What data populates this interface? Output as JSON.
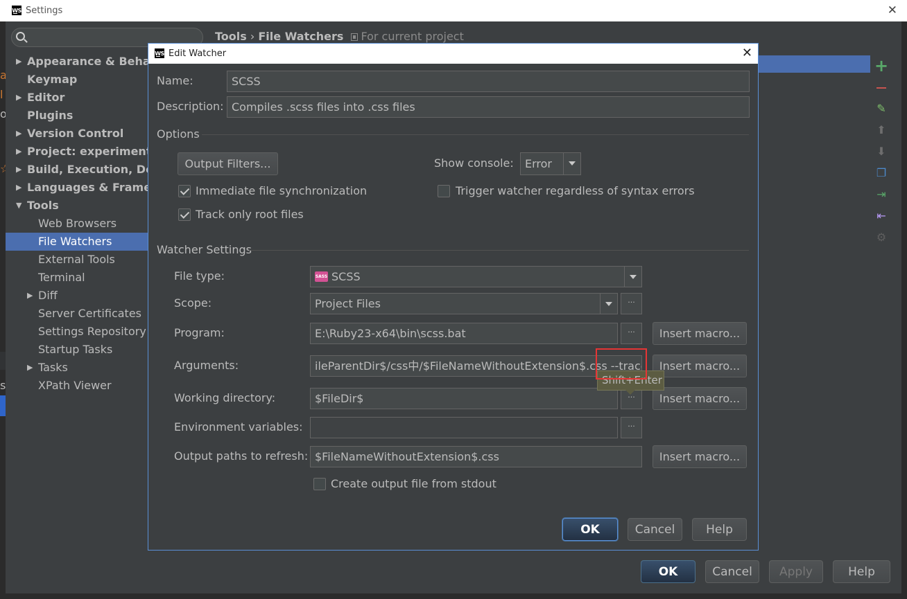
{
  "window": {
    "title": "Settings",
    "logo_text": "WS"
  },
  "sidebar": {
    "items": [
      {
        "label": "Appearance & Behavior",
        "bold": true,
        "arrow": "▶"
      },
      {
        "label": "Keymap",
        "bold": true,
        "arrow": ""
      },
      {
        "label": "Editor",
        "bold": true,
        "arrow": "▶"
      },
      {
        "label": "Plugins",
        "bold": true,
        "arrow": ""
      },
      {
        "label": "Version Control",
        "bold": true,
        "arrow": "▶"
      },
      {
        "label": "Project: experiment",
        "bold": true,
        "arrow": "▶"
      },
      {
        "label": "Build, Execution, Deployment",
        "bold": true,
        "arrow": "▶"
      },
      {
        "label": "Languages & Frameworks",
        "bold": true,
        "arrow": "▶"
      },
      {
        "label": "Tools",
        "bold": true,
        "arrow": "▼"
      },
      {
        "label": "Web Browsers"
      },
      {
        "label": "File Watchers",
        "selected": true
      },
      {
        "label": "External Tools"
      },
      {
        "label": "Terminal"
      },
      {
        "label": "Diff",
        "arrow": "▶"
      },
      {
        "label": "Server Certificates"
      },
      {
        "label": "Settings Repository"
      },
      {
        "label": "Startup Tasks"
      },
      {
        "label": "Tasks",
        "arrow": "▶"
      },
      {
        "label": "XPath Viewer"
      }
    ]
  },
  "breadcrumb": {
    "section": "Tools",
    "separator": "›",
    "page": "File Watchers",
    "scope": "For current project"
  },
  "outer_buttons": {
    "ok": "OK",
    "cancel": "Cancel",
    "apply": "Apply",
    "help": "Help"
  },
  "dialog": {
    "title": "Edit Watcher",
    "name_label": "Name:",
    "name_value": "SCSS",
    "description_label": "Description:",
    "description_value": "Compiles .scss files into .css files",
    "options_header": "Options",
    "output_filters_button": "Output Filters...",
    "show_console_label": "Show console:",
    "show_console_value": "Error",
    "immediate_sync_label": "Immediate file synchronization",
    "trigger_watcher_label": "Trigger watcher regardless of syntax errors",
    "track_root_label": "Track only root files",
    "watcher_settings_header": "Watcher Settings",
    "file_type_label": "File type:",
    "file_type_value": "SCSS",
    "file_type_icon_text": "SASS",
    "scope_label": "Scope:",
    "scope_value": "Project Files",
    "program_label": "Program:",
    "program_value": "E:\\Ruby23-x64\\bin\\scss.bat",
    "arguments_label": "Arguments:",
    "arguments_value": "ileParentDir$/css中/$FileNameWithoutExtension$.css --trace",
    "working_dir_label": "Working directory:",
    "working_dir_value": "$FileDir$",
    "env_vars_label": "Environment variables:",
    "env_vars_value": "",
    "output_paths_label": "Output paths to refresh:",
    "output_paths_value": "$FileNameWithoutExtension$.css",
    "create_output_label": "Create output file from stdout",
    "insert_macro_label": "Insert macro...",
    "dots_label": "···",
    "tooltip_text": "Shift+Enter",
    "ok": "OK",
    "cancel": "Cancel",
    "help": "Help"
  },
  "toolbar_icons": [
    "add-icon",
    "remove-icon",
    "edit-icon",
    "move-up-icon",
    "move-down-icon",
    "copy-icon",
    "import-icon",
    "export-icon",
    "settings-icon"
  ],
  "colors": {
    "accent": "#4b6eaf",
    "highlight_red": "#e63535",
    "add_green": "#59a869",
    "remove_red": "#c75450"
  }
}
